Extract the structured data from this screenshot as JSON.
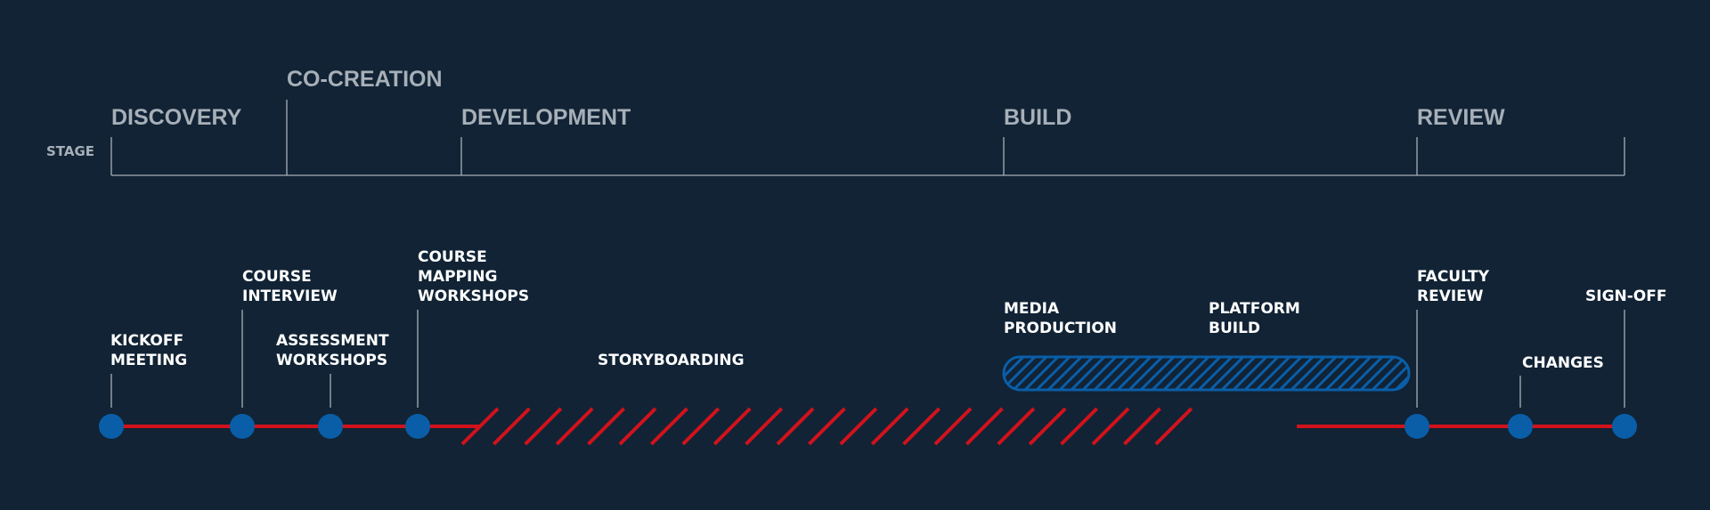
{
  "axis_label": "STAGE",
  "stages": [
    {
      "label": "DISCOVERY"
    },
    {
      "label": "CO-CREATION"
    },
    {
      "label": "DEVELOPMENT"
    },
    {
      "label": "BUILD"
    },
    {
      "label": "REVIEW"
    }
  ],
  "milestones": [
    {
      "label_lines": [
        "KICKOFF",
        "MEETING"
      ]
    },
    {
      "label_lines": [
        "COURSE",
        "INTERVIEW"
      ]
    },
    {
      "label_lines": [
        "ASSESSMENT",
        "WORKSHOPS"
      ]
    },
    {
      "label_lines": [
        "COURSE",
        "MAPPING",
        "WORKSHOPS"
      ]
    },
    {
      "label_lines": [
        "FACULTY",
        "REVIEW"
      ]
    },
    {
      "label_lines": [
        "CHANGES"
      ]
    },
    {
      "label_lines": [
        "SIGN-OFF"
      ]
    }
  ],
  "phases": {
    "storyboarding": "STORYBOARDING",
    "media_production": [
      "MEDIA",
      "PRODUCTION"
    ],
    "platform_build": [
      "PLATFORM",
      "BUILD"
    ]
  },
  "colors": {
    "background": "#112335",
    "stage_text": "#a7afb8",
    "bracket_line": "#a7afb8",
    "timeline": "#d2121b",
    "milestone_dot": "#0a5ea8",
    "build_bar": "#0a5ea8",
    "label_text": "#ffffff"
  }
}
